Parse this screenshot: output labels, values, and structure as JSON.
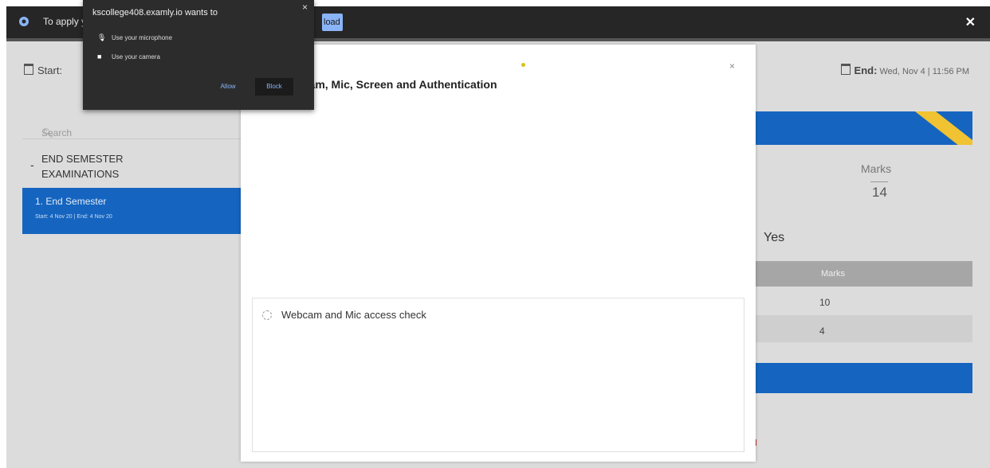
{
  "infobar": {
    "message": "To apply y",
    "download_label": "load",
    "gear_icon": "gear-icon",
    "close_icon": "close-icon"
  },
  "permission_popup": {
    "heading": "kscollege408.examly.io wants to",
    "options": [
      {
        "icon": "microphone-icon",
        "label": "Use your microphone"
      },
      {
        "icon": "camera-icon",
        "label": "Use your camera"
      }
    ],
    "allow_label": "Allow",
    "block_label": "Block",
    "close": "×"
  },
  "page": {
    "start_label": "Start:",
    "start_value": "",
    "end_label": "End:",
    "end_value": "Wed, Nov 4 | 11:56 PM",
    "search_placeholder": "Search",
    "section_title_line1": "END SEMESTER",
    "section_title_line2": "EXAMINATIONS",
    "collapse_glyph": "-",
    "sidebar_item": {
      "title": "1. End Semester",
      "dates": "Start: 4 Nov 20 | End: 4 Nov 20"
    },
    "marks_label": "Marks",
    "marks_value": "14",
    "yes_text": "Yes",
    "table_header": "Marks",
    "table_rows": [
      "10",
      "4"
    ]
  },
  "modal": {
    "title": "g Webcam, Mic, Screen and Authentication",
    "close": "×",
    "check_label": "Webcam and Mic access check"
  },
  "colors": {
    "primary_blue": "#1565c0",
    "ribbon_yellow": "#f1c232",
    "infobar_bg": "#262626"
  }
}
